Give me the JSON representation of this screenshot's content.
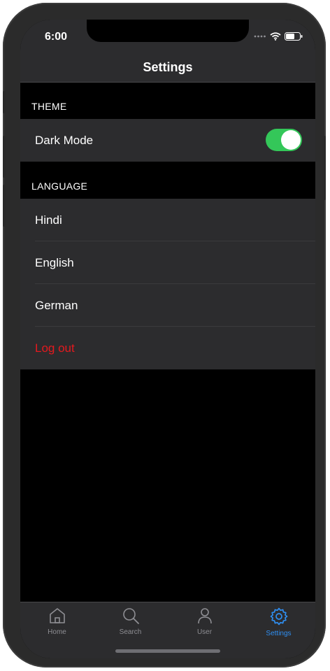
{
  "status_bar": {
    "time": "6:00"
  },
  "nav": {
    "title": "Settings"
  },
  "theme_section": {
    "header": "THEME",
    "dark_mode_label": "Dark Mode",
    "dark_mode_on": true
  },
  "language_section": {
    "header": "LANGUAGE",
    "options": [
      "Hindi",
      "English",
      "German"
    ]
  },
  "logout_label": "Log out",
  "tabs": [
    {
      "label": "Home",
      "icon": "home-icon",
      "active": false
    },
    {
      "label": "Search",
      "icon": "search-icon",
      "active": false
    },
    {
      "label": "User",
      "icon": "user-icon",
      "active": false
    },
    {
      "label": "Settings",
      "icon": "gear-icon",
      "active": true
    }
  ],
  "colors": {
    "toggle_on": "#34c759",
    "logout": "#e5191e",
    "tab_active": "#2f8ff2",
    "tab_inactive": "#8e8e93"
  }
}
